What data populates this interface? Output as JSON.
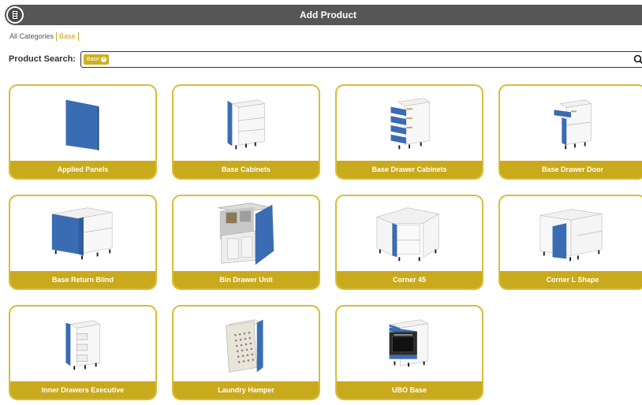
{
  "header": {
    "title": "Add Product",
    "logo": "cabinet-logo-icon"
  },
  "breadcrumb": {
    "root": "All Categories",
    "current": "Base"
  },
  "search": {
    "label": "Product Search:",
    "chip": "Base",
    "icon": "search-icon"
  },
  "colors": {
    "accent": "#c9aa1d",
    "titlebar": "#565656",
    "door_blue": "#3a6cb4"
  },
  "products": [
    {
      "label": "Applied Panels",
      "icon": "applied-panel-icon"
    },
    {
      "label": "Base Cabinets",
      "icon": "base-cabinet-icon"
    },
    {
      "label": "Base Drawer Cabinets",
      "icon": "drawer-cabinet-icon"
    },
    {
      "label": "Base Drawer Door",
      "icon": "drawer-door-cabinet-icon"
    },
    {
      "label": "Base Return Blind",
      "icon": "return-blind-cabinet-icon"
    },
    {
      "label": "Bin Drawer Unit",
      "icon": "bin-drawer-icon"
    },
    {
      "label": "Corner 45",
      "icon": "corner-45-cabinet-icon"
    },
    {
      "label": "Corner L Shape",
      "icon": "corner-l-cabinet-icon"
    },
    {
      "label": "Inner Drawers Executive",
      "icon": "inner-drawers-cabinet-icon"
    },
    {
      "label": "Laundry Hamper",
      "icon": "laundry-hamper-icon"
    },
    {
      "label": "UBO Base",
      "icon": "oven-cabinet-icon"
    }
  ]
}
